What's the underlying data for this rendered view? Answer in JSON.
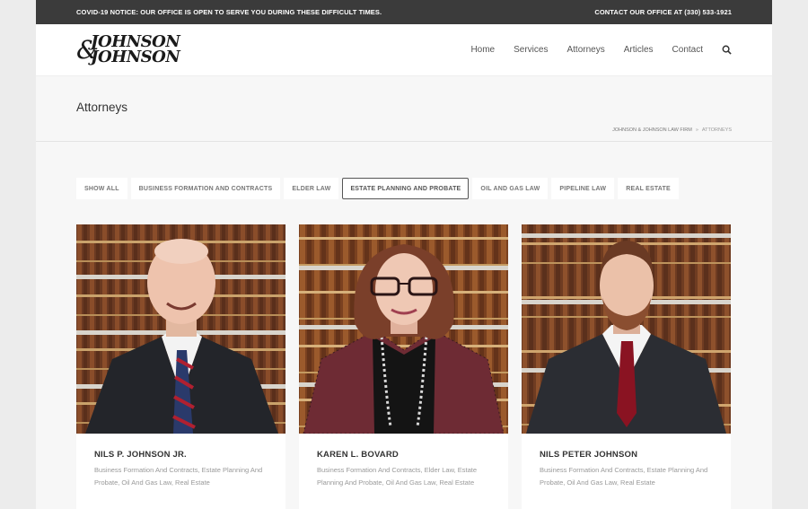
{
  "topbar": {
    "notice": "COVID-19 NOTICE: OUR OFFICE IS OPEN TO SERVE YOU DURING THESE DIFFICULT TIMES.",
    "contact": "CONTACT OUR OFFICE AT (330) 533-1921"
  },
  "logo": {
    "line1": "JOHNSON",
    "amp": "&",
    "line2": "JOHNSON"
  },
  "nav": {
    "items": [
      "Home",
      "Services",
      "Attorneys",
      "Articles",
      "Contact"
    ],
    "search_icon": "search-icon"
  },
  "page": {
    "title": "Attorneys",
    "breadcrumb": [
      "JOHNSON & JOHNSON LAW FIRM",
      "»",
      "ATTORNEYS"
    ]
  },
  "filters": {
    "items": [
      "SHOW ALL",
      "BUSINESS FORMATION AND CONTRACTS",
      "ELDER LAW",
      "ESTATE PLANNING AND PROBATE",
      "OIL AND GAS LAW",
      "PIPELINE LAW",
      "REAL ESTATE"
    ],
    "active": "ESTATE PLANNING AND PROBATE"
  },
  "attorneys": [
    {
      "name": "NILS P. JOHNSON JR.",
      "tags": "Business Formation And Contracts, Estate Planning And Probate, Oil And Gas Law, Real Estate"
    },
    {
      "name": "KAREN L. BOVARD",
      "tags": "Business Formation And Contracts, Elder Law, Estate Planning And Probate, Oil And Gas Law, Real Estate"
    },
    {
      "name": "NILS PETER JOHNSON",
      "tags": "Business Formation And Contracts, Estate Planning And Probate, Oil And Gas Law, Real Estate"
    }
  ],
  "colors": {
    "topbar": "#3b3b3b",
    "page_bg": "#f7f7f7",
    "card_bg": "#ffffff"
  }
}
